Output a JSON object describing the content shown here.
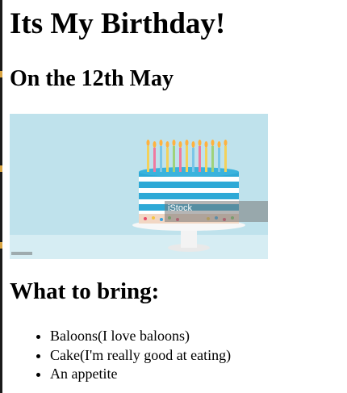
{
  "page": {
    "title": "Its My Birthday!",
    "subtitle": "On the 12th May",
    "image": {
      "alt_subject": "birthday-cake-with-candles",
      "watermark": "iStock",
      "background_color": "#b9dfea",
      "cake_stripe_colors": [
        "#2ea9d6",
        "#ffffff"
      ]
    },
    "section_heading": "What to bring:",
    "bring_list": [
      "Baloons(I love baloons)",
      "Cake(I'm really good at eating)",
      "An appetite"
    ]
  }
}
